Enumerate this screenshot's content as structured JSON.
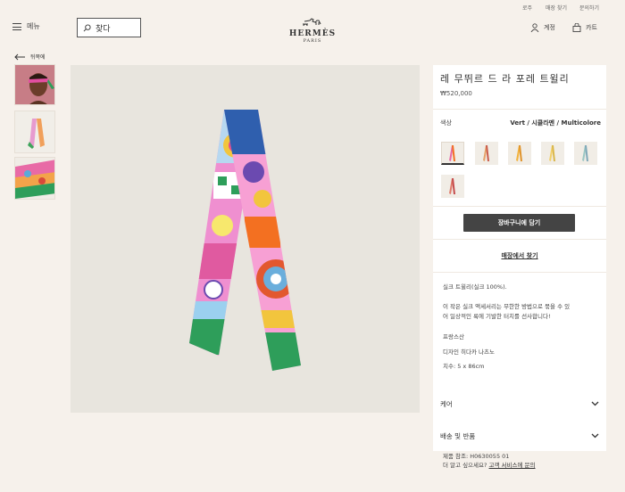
{
  "header": {
    "util_links": [
      "로주",
      "매장 찾기",
      "문의하기"
    ],
    "menu_label": "메뉴",
    "search_label": "찾다",
    "logo_word": "HERMÈS",
    "logo_city": "PARIS",
    "account_label": "계정",
    "cart_label": "카트"
  },
  "nav": {
    "back_label": "뒤쪽에"
  },
  "product": {
    "title": "레 무뛰르 드 라 포레 트윌리",
    "price": "₩520,000",
    "color_label": "색상",
    "color_value": "Vert / 시클라멘 / Multicolore",
    "add_to_cart": "장바구니에 담기",
    "find_in_store": "매장에서 찾기",
    "desc_material": "실크 트윌리(실크 100%).",
    "desc_line1": "이 작은 실크 액세서리는 무한한 방법으로 묶을 수 있",
    "desc_line2": "어 일상적인 룩에 기발한 터치를 선사합니다!",
    "origin": "프랑스산",
    "designer": "디자인 히다카 나츠노",
    "size": "치수: 5 x 86cm"
  },
  "accordion": {
    "care": "케어",
    "shipping": "배송 및 반품"
  },
  "footer": {
    "ref": "제품 참조: H0630055 01",
    "question": "더 알고 싶으세요?",
    "contact_link": "고객 서비스에 문의"
  },
  "colors": {
    "accent": "#f37021",
    "button": "#444444",
    "bg": "#f6f1eb"
  }
}
